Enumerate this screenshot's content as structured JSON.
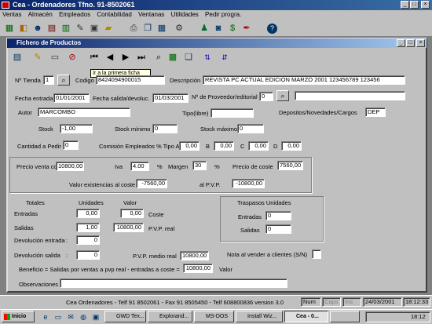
{
  "app": {
    "title": "Cea - Ordenadores  Tfno. 91-8502061"
  },
  "menu": [
    "Ventas",
    "Almacén",
    "Empleados",
    "Contabilidad",
    "Ventanas",
    "Utilidades",
    "Pedir progra."
  ],
  "window": {
    "title": "Fichero de Productos"
  },
  "tooltip": "Ir a la primera ficha",
  "form": {
    "tienda": {
      "label": "Nº Tienda",
      "value": "1"
    },
    "codigo": {
      "label": "Codigo",
      "value": "8424094900015"
    },
    "descripcion": {
      "label": "Descripción",
      "value": "REVISTA PC ACTUAL  EDICION MARZO 2001  123456789 123456"
    },
    "fecha_entrada": {
      "label": "Fecha entrada",
      "value": "01/01/2001"
    },
    "fecha_salida": {
      "label": "Fecha salida/devoluc.",
      "value": "01/03/2001"
    },
    "proveedor": {
      "label": "Nº de Proveedor/editorial",
      "value": "0",
      "name_value": ""
    },
    "autor": {
      "label": "Autor",
      "value": "MARCOMBO"
    },
    "tipo": {
      "label": "Tipo(libre)",
      "value": ""
    },
    "depositos": {
      "label": "Depositos/Novedades/Cargos",
      "value": "DEP"
    },
    "stock": {
      "label": "Stock",
      "value": "-1,00"
    },
    "stock_min": {
      "label": "Stock mínimo",
      "value": "0"
    },
    "stock_max": {
      "label": "Stock máximo",
      "value": "0"
    },
    "cantidad_pedir": {
      "label": "Cantidad a Pedir",
      "value": "0"
    },
    "comision": {
      "label": "Comisión Empleados % Tipo A",
      "a": "0,00",
      "b_label": "B",
      "b": "0,00",
      "c_label": "C",
      "c": "0,00",
      "d_label": "D",
      "d": "0,00"
    },
    "precio_venta": {
      "label": "Precio venta con IVA",
      "value": "10800,00"
    },
    "iva": {
      "label": "Iva",
      "value": "4.00",
      "pct": "%"
    },
    "margen": {
      "label": "Margen",
      "value": "30",
      "pct": "%"
    },
    "precio_coste": {
      "label": "Precio de coste",
      "value": "7560,00"
    },
    "valor_existencias": {
      "label": "Valor existencias al coste",
      "value": "-7560,00"
    },
    "al_pvp": {
      "label": "al P.V.P.",
      "value": "-10800,00"
    },
    "totales": {
      "header": "Totales",
      "col_unidades": "Unidades",
      "col_valor": "Valor",
      "entradas": {
        "label": "Entradas",
        "unidades": "0,00",
        "valor": "0,00",
        "suffix": "Coste"
      },
      "salidas": {
        "label": "Salidas",
        "unidades": "1,00",
        "valor": "10800,00",
        "suffix": "P.V.P. real"
      },
      "devolucion_entrada": {
        "label": "Devolución entrada",
        "value": "0"
      },
      "devolucion_salida": {
        "label": "Devolución salida",
        "value": "0"
      }
    },
    "pvp_medio": {
      "label": "P.V.P. medio real",
      "value": "10800,00"
    },
    "nota": {
      "label": "Nota al vender a clientes (S/N)",
      "value": ""
    },
    "beneficio": {
      "label": "Beneficio = Salidas por ventas a pvp real - entradas a coste =",
      "value": "10800,00",
      "suffix": "Valor"
    },
    "observaciones": {
      "label": "Observaciones",
      "value": ""
    },
    "traspasos": {
      "header": "Traspasos Unidades",
      "entradas": {
        "label": "Entradas",
        "value": "0"
      },
      "salidas": {
        "label": "Salidas",
        "value": "0"
      }
    }
  },
  "status": {
    "text": "Cea Ordenadores - Telf 91 8502061 - Fax 91 8505450 - Telf 608800836 version 3.0",
    "num": "Num",
    "caps": "Caps",
    "ins": "Ins",
    "date": "24/03/2001",
    "time": "18:12:33"
  },
  "taskbar": {
    "start": "Inicio",
    "tasks": [
      "GWD Tex...",
      "Explorand...",
      "MS-DOS",
      "Install Wiz...",
      "Cea - 0...",
      ""
    ],
    "clock": "18:12"
  }
}
